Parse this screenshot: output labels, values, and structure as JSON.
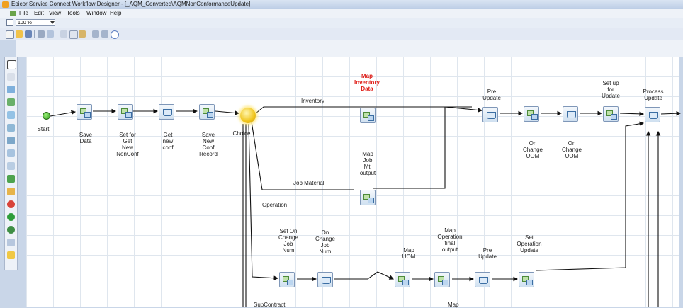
{
  "window": {
    "title": "Epicor Service Connect Workflow Designer - [_AQM_Converted\\AQMNonConformanceUpdate]"
  },
  "menu": [
    "File",
    "Edit",
    "View",
    "Tools",
    "Window",
    "Help"
  ],
  "zoom": {
    "value": "100 %"
  },
  "toolbar_icons": [
    "new-icon",
    "open-icon",
    "save-icon",
    "print-icon",
    "preview-icon",
    "cut-icon",
    "copy-icon",
    "paste-icon",
    "undo-icon",
    "redo-icon",
    "help-icon"
  ],
  "toolbox_icons": [
    "pointer-tool",
    "connector-tool",
    "activity-tool",
    "choice-tool",
    "loop-tool",
    "transform-tool",
    "call-tool",
    "service-tool",
    "database-tool",
    "event-tool",
    "delay-tool",
    "stop-tool",
    "start-tool",
    "end-tool",
    "comment-tool",
    "group-tool"
  ],
  "workflow": {
    "start": "Start",
    "choice": "Choice",
    "nodes": {
      "save_data": "Save\nData",
      "set_get_new": "Set for\nGet\nNew\nNonConf",
      "get_new_conf": "Get\nnew\nconf",
      "save_new_conf": "Save\nNew\nConf\nRecord",
      "map_inventory": "Map\nInventory\nData",
      "map_job_mtl": "Map\nJob\nMtl\noutput",
      "pre_update_top": "Pre\nUpdate",
      "on_change_uom_1": "On\nChange\nUOM",
      "on_change_uom_2": "On\nChange\nUOM",
      "set_up_update": "Set up\nfor\nUpdate",
      "process_update": "Process\nUpdate",
      "set_on_change_job": "Set On\nChange\nJob\nNum",
      "on_change_job": "On\nChange\nJob\nNum",
      "map_uom": "Map\nUOM",
      "map_op_final": "Map\nOperation\nfinal\noutput",
      "pre_update_bottom": "Pre\nUpdate",
      "set_op_update": "Set\nOperation\nUpdate"
    },
    "branches": {
      "inventory": "Inventory",
      "job_material": "Job Material",
      "operation": "Operation",
      "subcontract": "SubContract"
    },
    "cut_label": "Map"
  }
}
